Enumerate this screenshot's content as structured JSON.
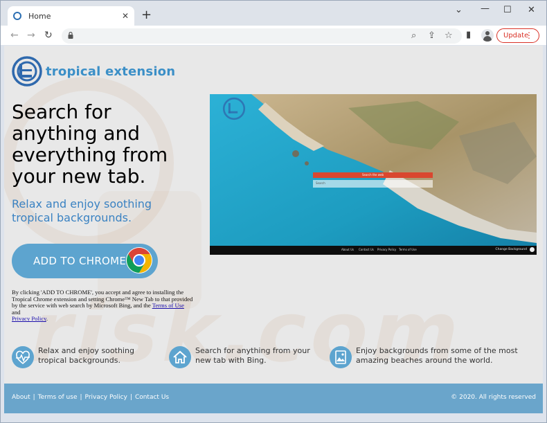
{
  "browser": {
    "tab_title": "Home",
    "update_label": "Update"
  },
  "logo": {
    "text": "tropical extension"
  },
  "hero": {
    "headline": "Search for anything and everything from your new tab.",
    "subline": "Relax and enjoy soothing tropical backgrounds.",
    "cta_label": "ADD TO CHROME"
  },
  "disclaimer": {
    "text_before": "By clicking 'ADD TO CHROME', you accept and agree to installing the Tropical Chrome extension and setting Chrome™ New Tab to that provided by the service with web search by Microsoft Bing, and the ",
    "terms_link": "Terms of Use",
    "text_middle": " and ",
    "privacy_link": "Privacy Policy",
    "text_after": "."
  },
  "preview": {
    "search_button": "Search the web",
    "search_placeholder": "Search",
    "links": [
      "About Us",
      "Contact Us",
      "Privacy Policy",
      "Terms of Use"
    ],
    "change_background": "Change Background"
  },
  "features": [
    {
      "icon": "heartbeat-icon",
      "text": "Relax and enjoy soothing tropical backgrounds."
    },
    {
      "icon": "home-icon",
      "text": "Search for anything from your new tab with Bing."
    },
    {
      "icon": "image-icon",
      "text": "Enjoy backgrounds from some of the most amazing beaches around the world."
    }
  ],
  "footer": {
    "links": [
      "About",
      "Terms of use",
      "Privacy Policy",
      "Contact Us"
    ],
    "copyright": "© 2020. All rights reserved"
  },
  "watermark": "risk.com",
  "colors": {
    "accent": "#5da4cf",
    "brand_text": "#3b8fc7",
    "update_red": "#d93025"
  }
}
